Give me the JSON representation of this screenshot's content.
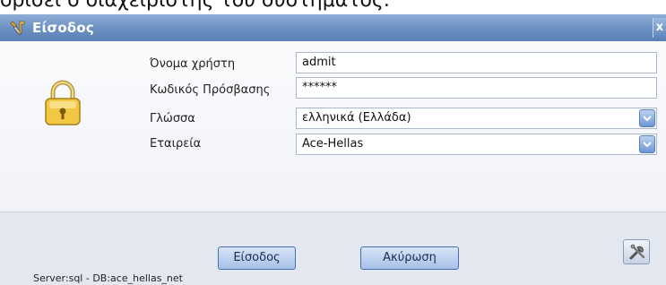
{
  "caption": "ορίσει ο διαχειριστής του συστήματος.",
  "window": {
    "title": "Είσοδος",
    "close_glyph": "x"
  },
  "form": {
    "username": {
      "label": "Όνομα χρήστη",
      "value": "admit"
    },
    "password": {
      "label": "Κωδικός Πρόσβασης",
      "value": "******"
    },
    "language": {
      "label": "Γλώσσα",
      "value": "ελληνικά (Ελλάδα)"
    },
    "company": {
      "label": "Εταιρεία",
      "value": "Ace-Hellas"
    }
  },
  "buttons": {
    "login": "Είσοδος",
    "cancel": "Ακύρωση"
  },
  "status": "Server:sql - DB:ace_hellas_net",
  "icons": {
    "title": "tools-icon",
    "lock": "lock-icon",
    "settings": "tools-icon",
    "dropdown": "chevron-down-icon"
  }
}
